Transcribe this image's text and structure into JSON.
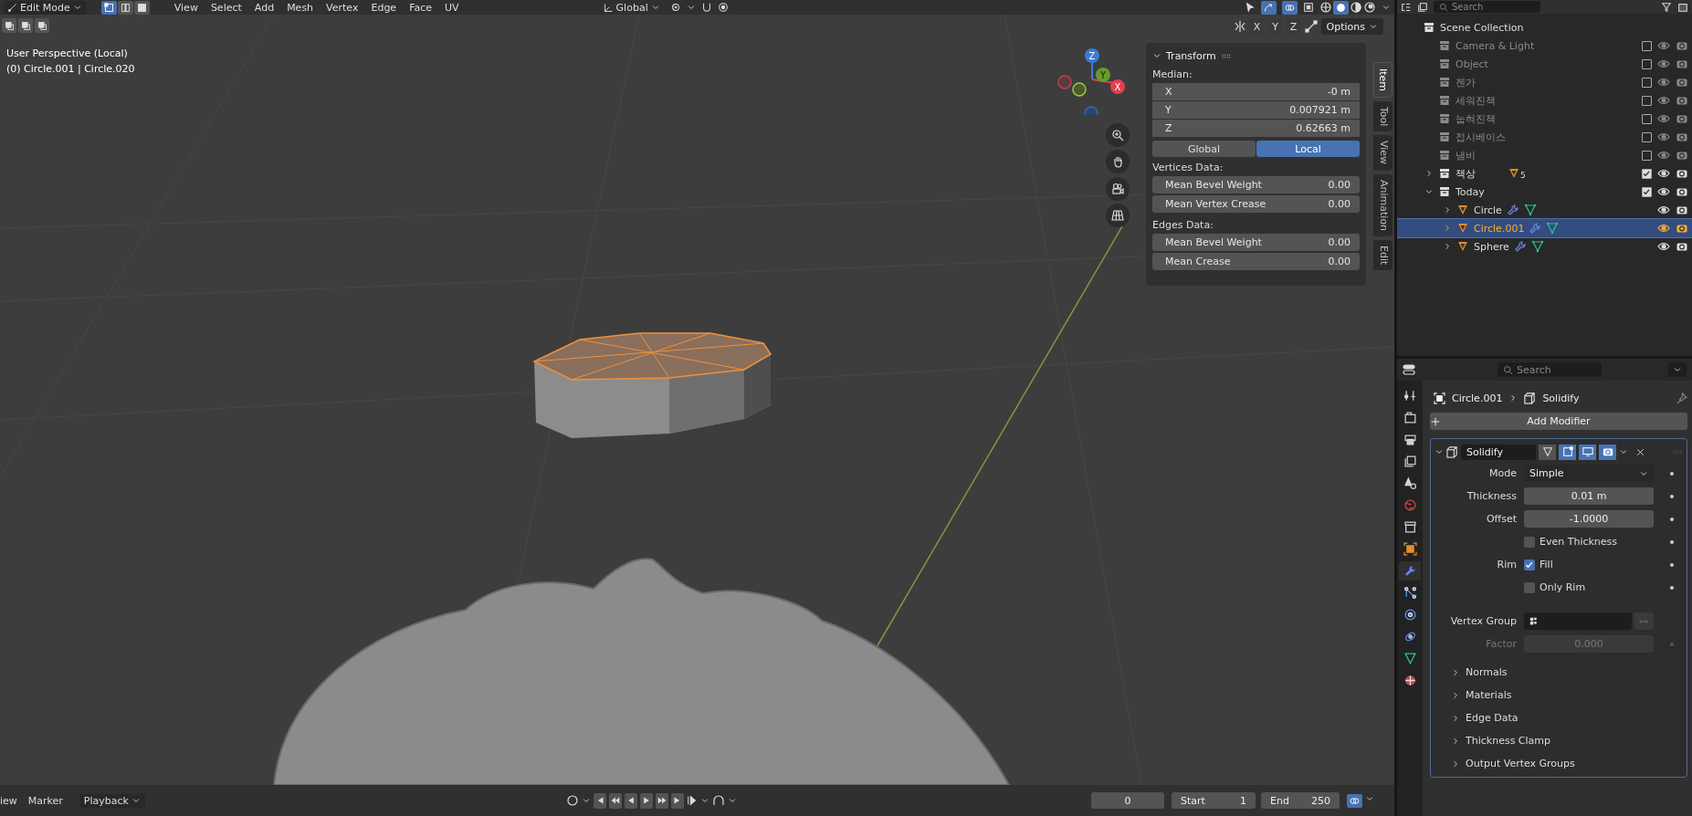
{
  "header": {
    "mode": "Edit Mode",
    "select_modes": [
      {
        "kind": "vertex",
        "selected": true
      },
      {
        "kind": "edge",
        "selected": false
      },
      {
        "kind": "face",
        "selected": false
      }
    ],
    "menus": [
      "View",
      "Select",
      "Add",
      "Mesh",
      "Vertex",
      "Edge",
      "Face",
      "UV"
    ],
    "orientation": "Global"
  },
  "viewport": {
    "info": [
      "User Perspective (Local)",
      "(0) Circle.001 | Circle.020"
    ],
    "mirror_axes": [
      "X",
      "Y",
      "Z"
    ],
    "options": "Options",
    "gizmo_labels": [
      "Z",
      "Y",
      "X"
    ]
  },
  "transform_panel": {
    "title": "Transform",
    "median_label": "Median:",
    "coords": [
      {
        "axis": "X",
        "value": "-0 m"
      },
      {
        "axis": "Y",
        "value": "0.007921 m"
      },
      {
        "axis": "Z",
        "value": "0.62663 m"
      }
    ],
    "space": [
      {
        "label": "Global",
        "selected": false
      },
      {
        "label": "Local",
        "selected": true
      }
    ],
    "sections": [
      {
        "title": "Vertices Data:",
        "fields": [
          {
            "label": "Mean Bevel Weight",
            "value": "0.00"
          },
          {
            "label": "Mean Vertex Crease",
            "value": "0.00"
          }
        ]
      },
      {
        "title": "Edges Data:",
        "fields": [
          {
            "label": "Mean Bevel Weight",
            "value": "0.00"
          },
          {
            "label": "Mean Crease",
            "value": "0.00"
          }
        ]
      }
    ]
  },
  "side_tabs": [
    {
      "label": "Item",
      "selected": true
    },
    {
      "label": "Tool",
      "selected": false
    },
    {
      "label": "View",
      "selected": false
    },
    {
      "label": "Animation",
      "selected": false
    },
    {
      "label": "Edit",
      "selected": false
    }
  ],
  "outliner": {
    "search_placeholder": "Search",
    "root": "Scene Collection",
    "items": [
      {
        "name": "Camera & Light",
        "kind": "collection",
        "checked": false
      },
      {
        "name": "Object",
        "kind": "collection",
        "checked": false
      },
      {
        "name": "젠가",
        "kind": "collection",
        "checked": false
      },
      {
        "name": "세워진책",
        "kind": "collection",
        "checked": false
      },
      {
        "name": "눕혀진책",
        "kind": "collection",
        "checked": false
      },
      {
        "name": "접시베이스",
        "kind": "collection",
        "checked": false
      },
      {
        "name": "냄비",
        "kind": "collection",
        "checked": false
      },
      {
        "name": "책상",
        "kind": "collection",
        "checked": true,
        "expanded": false,
        "badge": "5"
      },
      {
        "name": "Today",
        "kind": "collection",
        "checked": true,
        "expanded": true,
        "children": [
          {
            "name": "Circle",
            "kind": "object",
            "expanded": false,
            "selected": false
          },
          {
            "name": "Circle.001",
            "kind": "object",
            "expanded": false,
            "selected": true
          },
          {
            "name": "Sphere",
            "kind": "object",
            "expanded": false,
            "selected": false
          }
        ]
      }
    ]
  },
  "properties": {
    "search_placeholder": "Search",
    "tabs": [
      {
        "kind": "tool",
        "selected": false
      },
      {
        "kind": "render",
        "selected": false
      },
      {
        "kind": "output",
        "selected": false
      },
      {
        "kind": "view_layer",
        "selected": false
      },
      {
        "kind": "scene",
        "selected": false
      },
      {
        "kind": "world",
        "selected": false
      },
      {
        "kind": "collection",
        "selected": false
      },
      {
        "kind": "object",
        "selected": false
      },
      {
        "kind": "modifier",
        "selected": true
      },
      {
        "kind": "particles",
        "selected": false
      },
      {
        "kind": "physics",
        "selected": false
      },
      {
        "kind": "constraints",
        "selected": false
      },
      {
        "kind": "data",
        "selected": false
      },
      {
        "kind": "material",
        "selected": false
      }
    ],
    "breadcrumb": [
      "Circle.001",
      "Solidify"
    ],
    "add_modifier": "Add Modifier",
    "modifier": {
      "name": "Solidify",
      "toggles": [
        {
          "kind": "cage",
          "on": false
        },
        {
          "kind": "edit",
          "on": true
        },
        {
          "kind": "viewport",
          "on": true
        },
        {
          "kind": "render",
          "on": true
        }
      ],
      "rows": [
        {
          "kind": "dropdown",
          "label": "Mode",
          "value": "Simple"
        },
        {
          "kind": "number",
          "label": "Thickness",
          "value": "0.01 m"
        },
        {
          "kind": "number",
          "label": "Offset",
          "value": "-1.0000"
        },
        {
          "kind": "checkbox",
          "text": "Even Thickness",
          "checked": false
        },
        {
          "kind": "checkbox",
          "label": "Rim",
          "text": "Fill",
          "checked": true
        },
        {
          "kind": "checkbox",
          "text": "Only Rim",
          "checked": false
        },
        {
          "kind": "vertex_group",
          "label": "Vertex Group"
        },
        {
          "kind": "number",
          "label": "Factor",
          "value": "0.000",
          "disabled": true
        }
      ],
      "subpanels": [
        "Normals",
        "Materials",
        "Edge Data",
        "Thickness Clamp",
        "Output Vertex Groups"
      ]
    }
  },
  "timeline": {
    "menus": [
      "iew",
      "Marker"
    ],
    "playback": "Playback",
    "frame": "0",
    "start_label": "Start",
    "start": "1",
    "end_label": "End",
    "end": "250"
  }
}
